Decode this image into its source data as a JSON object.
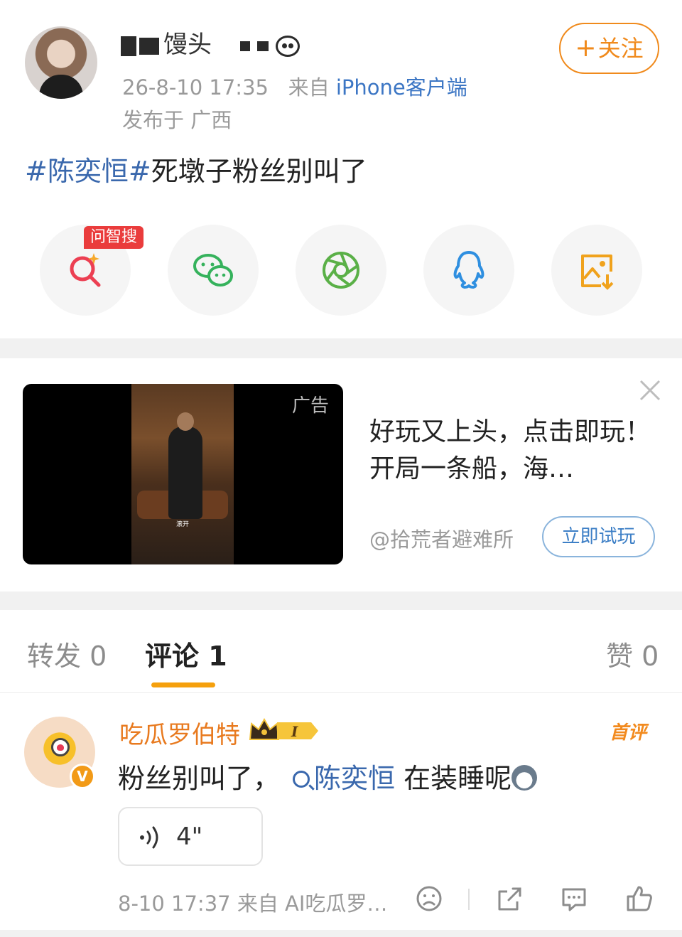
{
  "post": {
    "username": "馒头",
    "time": "26-8-10 17:35",
    "source_prefix": "来自",
    "source_app": "iPhone客户端",
    "location": "发布于 广西",
    "follow_label": "关注",
    "follow_plus": "+",
    "topic": "#陈奕恒#",
    "text": "死墩子粉丝别叫了",
    "share_badge": "问智搜",
    "share_items": [
      "smart-search",
      "wechat",
      "moments",
      "qq",
      "save-image"
    ]
  },
  "ad": {
    "label": "广告",
    "caption": "滚开",
    "title": "好玩又上头，点击即玩！开局一条船，海…",
    "source": "@拾荒者避难所",
    "cta": "立即试玩"
  },
  "tabs": {
    "repost": "转发 0",
    "comments": "评论 1",
    "likes": "赞 0"
  },
  "comment": {
    "name": "吃瓜罗伯特",
    "level": "I",
    "first_tag": "首评",
    "text_before": "粉丝别叫了，",
    "mention": "陈奕恒",
    "text_after": " 在装睡呢",
    "voice_duration": "4\"",
    "meta": "8-10 17:37  来自 AI吃瓜罗…",
    "vbadge": "V"
  },
  "colors": {
    "accent_orange": "#f08a1c",
    "link_blue": "#3a68ad",
    "tab_underline": "#f5a00d",
    "badge_red": "#ea3c3c"
  }
}
